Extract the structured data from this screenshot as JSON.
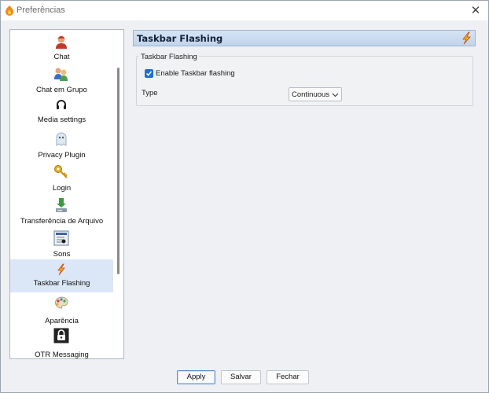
{
  "window": {
    "title": "Preferências",
    "close_glyph": "✕"
  },
  "sidebar": {
    "items": [
      {
        "label": "Chat",
        "icon": "chat-user-icon",
        "selected": false
      },
      {
        "label": "Chat em Grupo",
        "icon": "group-chat-icon",
        "selected": false
      },
      {
        "label": "Media settings",
        "icon": "headset-icon",
        "selected": false
      },
      {
        "label": "Privacy Plugin",
        "icon": "ghost-icon",
        "selected": false
      },
      {
        "label": "Login",
        "icon": "key-icon",
        "selected": false
      },
      {
        "label": "Transferência de Arquivo",
        "icon": "file-transfer-icon",
        "selected": false
      },
      {
        "label": "Sons",
        "icon": "sound-icon",
        "selected": false
      },
      {
        "label": "Taskbar Flashing",
        "icon": "lightning-icon",
        "selected": true
      },
      {
        "label": "Aparência",
        "icon": "palette-icon",
        "selected": false
      },
      {
        "label": "OTR Messaging",
        "icon": "otr-lock-icon",
        "selected": false
      }
    ]
  },
  "panel": {
    "title": "Taskbar Flashing",
    "group_title": "Taskbar Flashing",
    "enable_label": "Enable Taskbar flashing",
    "enable_checked": true,
    "type_label": "Type",
    "type_value": "Continuous"
  },
  "footer": {
    "apply_label": "Apply",
    "save_label": "Salvar",
    "close_label": "Fechar"
  },
  "colors": {
    "accent": "#1f6fd1",
    "selected_bg": "#dbe7f7",
    "header_bg": "#c8d8ee"
  }
}
